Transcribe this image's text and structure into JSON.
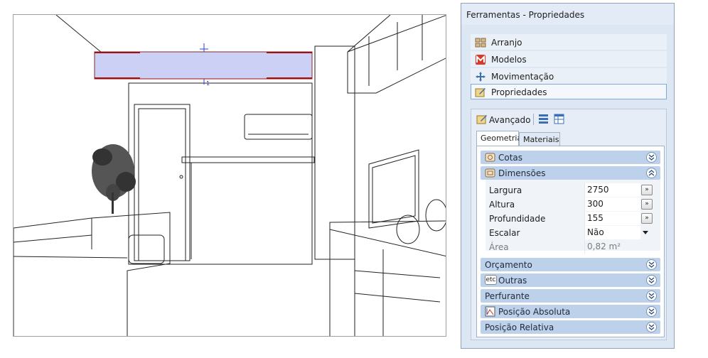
{
  "panel": {
    "title": "Ferramentas - Propriedades",
    "tools": [
      {
        "label": "Arranjo",
        "icon": "arrange-icon"
      },
      {
        "label": "Modelos",
        "icon": "models-icon"
      },
      {
        "label": "Movimentação",
        "icon": "move-icon"
      },
      {
        "label": "Propriedades",
        "icon": "properties-icon"
      }
    ],
    "advanced": {
      "label": "Avançado",
      "tabs": [
        "Geometria",
        "Materiais"
      ],
      "sections": {
        "cotas": "Cotas",
        "dimensoes": "Dimensões",
        "orcamento": "Orçamento",
        "outras": "Outras",
        "outras_icon_text": "etc",
        "perfurante": "Perfurante",
        "posicao_absoluta": "Posição Absoluta",
        "posicao_relativa": "Posição Relativa"
      },
      "properties": {
        "largura": {
          "label": "Largura",
          "value": "2750",
          "button": "»"
        },
        "altura": {
          "label": "Altura",
          "value": "300",
          "button": "»"
        },
        "profundidade": {
          "label": "Profundidade",
          "value": "155",
          "button": "»"
        },
        "escalar": {
          "label": "Escalar",
          "value": "Não"
        },
        "area": {
          "label": "Área",
          "value": "0,82 m²"
        }
      }
    }
  },
  "viewport": {
    "dimension_label": "1"
  },
  "colors": {
    "selection_fill": "#ccd0f4",
    "selection_edge": "#a01010",
    "section_header": "#bed1ea",
    "panel_bg": "#dde7f3"
  }
}
